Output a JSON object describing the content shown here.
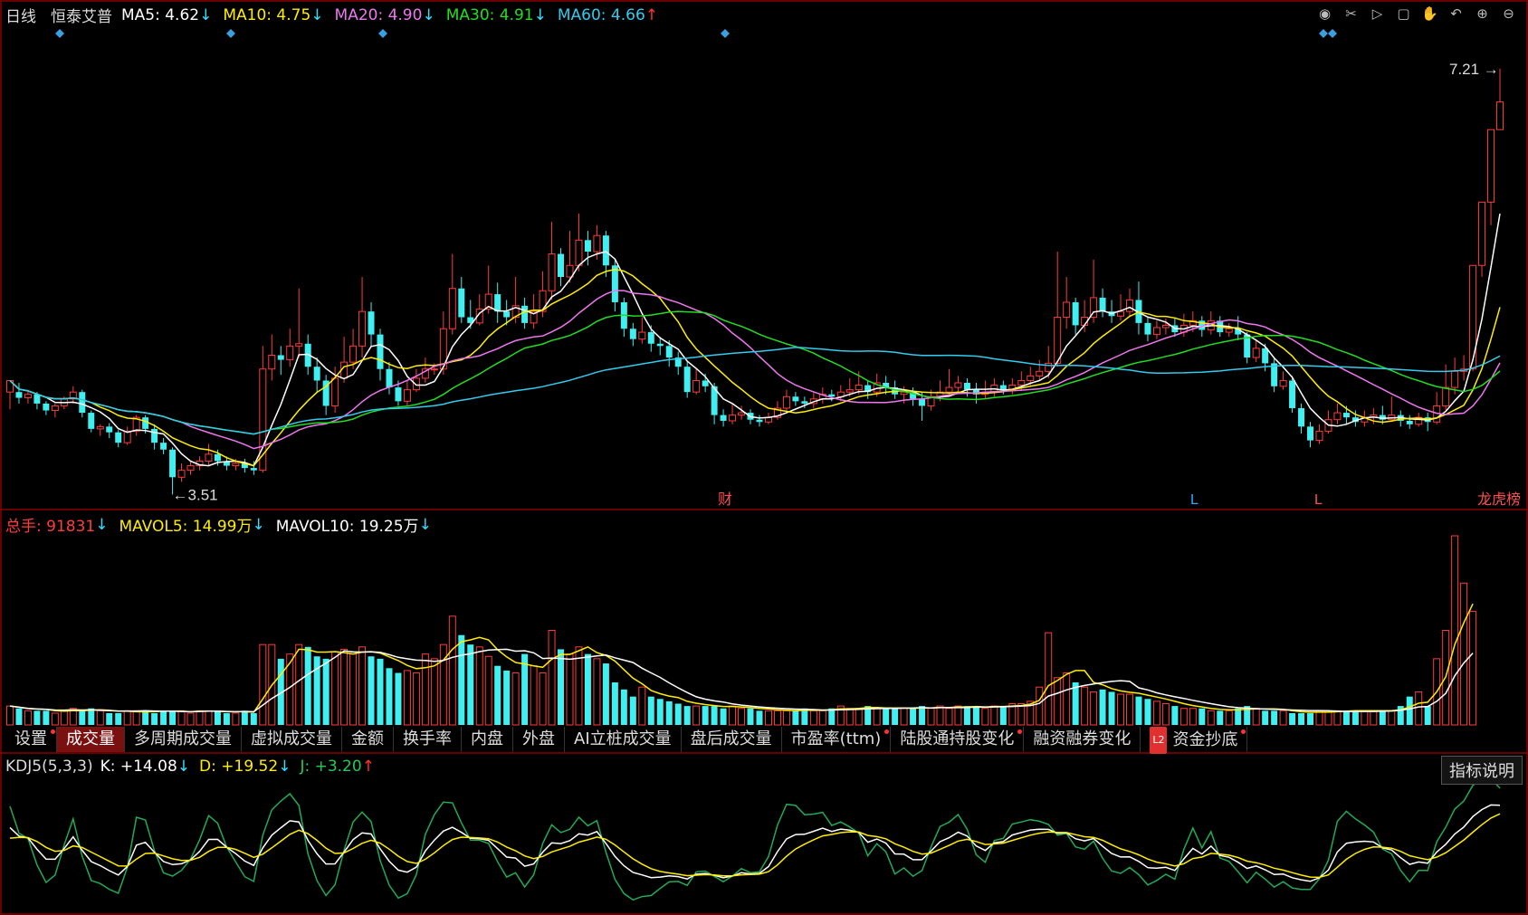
{
  "header": {
    "period": "日线",
    "stock_name": "恒泰艾普",
    "ma": [
      {
        "label": "MA5: 4.62",
        "arrow": "↓",
        "color": "#ffffff",
        "arrow_color": "#30e0ff"
      },
      {
        "label": "MA10: 4.75",
        "arrow": "↓",
        "color": "#ffee00",
        "arrow_color": "#30e0ff"
      },
      {
        "label": "MA20: 4.90",
        "arrow": "↓",
        "color": "#ee77ee",
        "arrow_color": "#30e0ff"
      },
      {
        "label": "MA30: 4.91",
        "arrow": "↓",
        "color": "#22dd22",
        "arrow_color": "#30e0ff"
      },
      {
        "label": "MA60: 4.66",
        "arrow": "↑",
        "color": "#33ccee",
        "arrow_color": "#ff3333"
      }
    ]
  },
  "price_annotations": {
    "high_label": "7.21",
    "low_label": "3.51"
  },
  "event_markers": [
    "财",
    "L",
    "L",
    "龙虎榜"
  ],
  "volume_header": {
    "total": "总手: 91831",
    "total_arrow": "↓",
    "mavol5": "MAVOL5: 14.99万",
    "mavol5_arrow": "↓",
    "mavol10": "MAVOL10: 19.25万",
    "mavol10_arrow": "↓"
  },
  "tabs": [
    {
      "label": "设置",
      "active": false,
      "dot": true
    },
    {
      "label": "成交量",
      "active": true,
      "dot": false
    },
    {
      "label": "多周期成交量",
      "active": false,
      "dot": false
    },
    {
      "label": "虚拟成交量",
      "active": false,
      "dot": false
    },
    {
      "label": "金额",
      "active": false,
      "dot": false
    },
    {
      "label": "换手率",
      "active": false,
      "dot": false
    },
    {
      "label": "内盘",
      "active": false,
      "dot": false
    },
    {
      "label": "外盘",
      "active": false,
      "dot": false
    },
    {
      "label": "AI立桩成交量",
      "active": false,
      "dot": false
    },
    {
      "label": "盘后成交量",
      "active": false,
      "dot": false
    },
    {
      "label": "市盈率(ttm)",
      "active": false,
      "dot": true
    },
    {
      "label": "陆股通持股变化",
      "active": false,
      "dot": true
    },
    {
      "label": "融资融券变化",
      "active": false,
      "dot": false
    },
    {
      "label": "资金抄底",
      "active": false,
      "dot": true,
      "badge": "L2"
    }
  ],
  "kdj_header": {
    "name": "KDJ5(5,3,3)",
    "k": "K: +14.08",
    "k_arrow": "↓",
    "d": "D: +19.52",
    "d_arrow": "↓",
    "j": "J: +3.20",
    "j_arrow": "↑"
  },
  "explain_button": "指标说明",
  "toolbar_icons": [
    "eye-icon",
    "scissors-icon",
    "play-icon",
    "lock-icon",
    "hand-icon",
    "undo-icon",
    "zoom-in-icon",
    "zoom-out-icon"
  ],
  "colors": {
    "up": "#ff3b3b",
    "down": "#40f0f0",
    "frame": "#8b0000"
  },
  "chart_data": {
    "type": "candlestick",
    "y_range_price": [
      3.45,
      7.35
    ],
    "ohlc": [
      [
        4.4,
        4.5,
        4.5,
        4.25
      ],
      [
        4.4,
        4.35,
        4.48,
        4.3
      ],
      [
        4.35,
        4.38,
        4.42,
        4.3
      ],
      [
        4.38,
        4.3,
        4.4,
        4.25
      ],
      [
        4.3,
        4.24,
        4.32,
        4.2
      ],
      [
        4.24,
        4.28,
        4.3,
        4.18
      ],
      [
        4.28,
        4.34,
        4.36,
        4.25
      ],
      [
        4.34,
        4.4,
        4.45,
        4.3
      ],
      [
        4.4,
        4.22,
        4.42,
        4.18
      ],
      [
        4.22,
        4.08,
        4.24,
        4.05
      ],
      [
        4.08,
        4.1,
        4.12,
        4.02
      ],
      [
        4.1,
        4.05,
        4.13,
        4.0
      ],
      [
        4.05,
        3.96,
        4.07,
        3.92
      ],
      [
        3.96,
        4.06,
        4.1,
        3.94
      ],
      [
        4.06,
        4.18,
        4.2,
        4.02
      ],
      [
        4.18,
        4.08,
        4.2,
        4.04
      ],
      [
        4.08,
        3.96,
        4.12,
        3.9
      ],
      [
        3.96,
        3.9,
        4.0,
        3.86
      ],
      [
        3.9,
        3.66,
        3.92,
        3.51
      ],
      [
        3.66,
        3.72,
        3.78,
        3.62
      ],
      [
        3.72,
        3.76,
        3.8,
        3.68
      ],
      [
        3.76,
        3.8,
        3.84,
        3.72
      ],
      [
        3.8,
        3.86,
        3.95,
        3.76
      ],
      [
        3.86,
        3.8,
        3.9,
        3.76
      ],
      [
        3.8,
        3.76,
        3.84,
        3.72
      ],
      [
        3.76,
        3.78,
        3.82,
        3.72
      ],
      [
        3.78,
        3.74,
        3.82,
        3.7
      ],
      [
        3.74,
        3.72,
        3.8,
        3.68
      ],
      [
        3.72,
        4.6,
        4.8,
        3.7
      ],
      [
        4.6,
        4.72,
        4.9,
        4.5
      ],
      [
        4.72,
        4.68,
        4.8,
        4.55
      ],
      [
        4.68,
        4.8,
        4.95,
        4.62
      ],
      [
        4.8,
        4.82,
        5.3,
        4.7
      ],
      [
        4.82,
        4.62,
        4.9,
        4.55
      ],
      [
        4.62,
        4.5,
        4.7,
        4.4
      ],
      [
        4.5,
        4.28,
        4.55,
        4.2
      ],
      [
        4.28,
        4.52,
        4.62,
        4.22
      ],
      [
        4.52,
        4.66,
        4.88,
        4.48
      ],
      [
        4.66,
        4.8,
        4.95,
        4.6
      ],
      [
        4.8,
        5.1,
        5.4,
        4.7
      ],
      [
        5.1,
        4.9,
        5.18,
        4.8
      ],
      [
        4.9,
        4.6,
        4.95,
        4.5
      ],
      [
        4.6,
        4.44,
        4.66,
        4.38
      ],
      [
        4.44,
        4.32,
        4.5,
        4.28
      ],
      [
        4.32,
        4.42,
        4.5,
        4.28
      ],
      [
        4.42,
        4.52,
        4.6,
        4.4
      ],
      [
        4.52,
        4.6,
        4.7,
        4.48
      ],
      [
        4.6,
        4.6,
        4.65,
        4.55
      ],
      [
        4.6,
        4.95,
        5.1,
        4.55
      ],
      [
        4.95,
        5.3,
        5.6,
        4.9
      ],
      [
        5.3,
        5.05,
        5.4,
        5.0
      ],
      [
        5.05,
        5.0,
        5.2,
        4.95
      ],
      [
        5.0,
        5.12,
        5.25,
        4.98
      ],
      [
        5.12,
        5.25,
        5.5,
        5.08
      ],
      [
        5.25,
        5.1,
        5.35,
        5.0
      ],
      [
        5.1,
        5.05,
        5.2,
        4.98
      ],
      [
        5.05,
        5.15,
        5.4,
        5.0
      ],
      [
        5.15,
        5.0,
        5.22,
        4.95
      ],
      [
        5.0,
        5.1,
        5.25,
        4.95
      ],
      [
        5.1,
        5.28,
        5.45,
        5.05
      ],
      [
        5.28,
        5.6,
        5.88,
        5.2
      ],
      [
        5.6,
        5.4,
        5.65,
        5.32
      ],
      [
        5.4,
        5.5,
        5.8,
        5.35
      ],
      [
        5.5,
        5.72,
        5.95,
        5.45
      ],
      [
        5.72,
        5.62,
        5.8,
        5.5
      ],
      [
        5.62,
        5.76,
        5.85,
        5.55
      ],
      [
        5.76,
        5.5,
        5.8,
        5.4
      ],
      [
        5.5,
        5.18,
        5.55,
        5.1
      ],
      [
        5.18,
        4.95,
        5.22,
        4.88
      ],
      [
        4.95,
        4.86,
        5.0,
        4.8
      ],
      [
        4.86,
        4.92,
        5.05,
        4.82
      ],
      [
        4.92,
        4.82,
        4.98,
        4.75
      ],
      [
        4.82,
        4.8,
        4.88,
        4.72
      ],
      [
        4.8,
        4.7,
        4.85,
        4.62
      ],
      [
        4.7,
        4.62,
        4.75,
        4.55
      ],
      [
        4.62,
        4.4,
        4.66,
        4.35
      ],
      [
        4.4,
        4.5,
        4.6,
        4.38
      ],
      [
        4.5,
        4.45,
        4.56,
        4.4
      ],
      [
        4.45,
        4.2,
        4.48,
        4.12
      ],
      [
        4.2,
        4.15,
        4.25,
        4.1
      ],
      [
        4.15,
        4.2,
        4.3,
        4.12
      ],
      [
        4.2,
        4.22,
        4.28,
        4.16
      ],
      [
        4.22,
        4.16,
        4.25,
        4.12
      ],
      [
        4.16,
        4.14,
        4.2,
        4.1
      ],
      [
        4.14,
        4.18,
        4.22,
        4.12
      ],
      [
        4.18,
        4.26,
        4.32,
        4.16
      ],
      [
        4.26,
        4.36,
        4.42,
        4.22
      ],
      [
        4.36,
        4.32,
        4.4,
        4.28
      ],
      [
        4.32,
        4.3,
        4.36,
        4.26
      ],
      [
        4.3,
        4.34,
        4.4,
        4.26
      ],
      [
        4.34,
        4.38,
        4.44,
        4.3
      ],
      [
        4.38,
        4.36,
        4.42,
        4.32
      ],
      [
        4.36,
        4.4,
        4.46,
        4.32
      ],
      [
        4.4,
        4.42,
        4.52,
        4.36
      ],
      [
        4.42,
        4.46,
        4.58,
        4.38
      ],
      [
        4.46,
        4.4,
        4.5,
        4.34
      ],
      [
        4.4,
        4.48,
        4.56,
        4.36
      ],
      [
        4.48,
        4.44,
        4.54,
        4.38
      ],
      [
        4.44,
        4.38,
        4.5,
        4.34
      ],
      [
        4.38,
        4.4,
        4.45,
        4.3
      ],
      [
        4.4,
        4.34,
        4.44,
        4.28
      ],
      [
        4.34,
        4.28,
        4.4,
        4.15
      ],
      [
        4.28,
        4.36,
        4.42,
        4.24
      ],
      [
        4.36,
        4.4,
        4.5,
        4.32
      ],
      [
        4.4,
        4.44,
        4.6,
        4.36
      ],
      [
        4.44,
        4.48,
        4.54,
        4.4
      ],
      [
        4.48,
        4.42,
        4.52,
        4.36
      ],
      [
        4.42,
        4.38,
        4.48,
        4.3
      ],
      [
        4.38,
        4.4,
        4.5,
        4.34
      ],
      [
        4.4,
        4.46,
        4.52,
        4.36
      ],
      [
        4.46,
        4.42,
        4.5,
        4.38
      ],
      [
        4.42,
        4.46,
        4.52,
        4.38
      ],
      [
        4.46,
        4.5,
        4.58,
        4.42
      ],
      [
        4.5,
        4.54,
        4.62,
        4.46
      ],
      [
        4.54,
        4.58,
        4.68,
        4.5
      ],
      [
        4.58,
        4.65,
        4.8,
        4.52
      ],
      [
        4.65,
        5.05,
        5.62,
        4.62
      ],
      [
        5.05,
        5.18,
        5.4,
        4.95
      ],
      [
        5.18,
        4.98,
        5.22,
        4.9
      ],
      [
        4.98,
        5.05,
        5.2,
        4.92
      ],
      [
        5.05,
        5.22,
        5.55,
        5.0
      ],
      [
        5.22,
        5.1,
        5.3,
        5.05
      ],
      [
        5.1,
        5.06,
        5.2,
        5.0
      ],
      [
        5.06,
        5.1,
        5.25,
        5.02
      ],
      [
        5.1,
        5.2,
        5.3,
        5.05
      ],
      [
        5.2,
        5.0,
        5.36,
        4.9
      ],
      [
        5.0,
        4.9,
        5.05,
        4.84
      ],
      [
        4.9,
        4.96,
        5.02,
        4.86
      ],
      [
        4.96,
        4.98,
        5.04,
        4.9
      ],
      [
        4.98,
        4.92,
        5.05,
        4.88
      ],
      [
        4.92,
        4.98,
        5.08,
        4.88
      ],
      [
        4.98,
        5.02,
        5.1,
        4.92
      ],
      [
        5.02,
        4.94,
        5.06,
        4.88
      ],
      [
        4.94,
        5.02,
        5.1,
        4.9
      ],
      [
        5.02,
        4.92,
        5.06,
        4.88
      ],
      [
        4.92,
        4.95,
        5.0,
        4.88
      ],
      [
        4.95,
        4.9,
        5.06,
        4.85
      ],
      [
        4.9,
        4.7,
        4.92,
        4.65
      ],
      [
        4.7,
        4.78,
        4.85,
        4.66
      ],
      [
        4.78,
        4.65,
        4.82,
        4.58
      ],
      [
        4.65,
        4.45,
        4.7,
        4.4
      ],
      [
        4.45,
        4.5,
        4.58,
        4.42
      ],
      [
        4.5,
        4.26,
        4.54,
        4.22
      ],
      [
        4.26,
        4.1,
        4.3,
        4.04
      ],
      [
        4.1,
        3.98,
        4.14,
        3.92
      ],
      [
        3.98,
        4.06,
        4.12,
        3.95
      ],
      [
        4.06,
        4.16,
        4.24,
        4.04
      ],
      [
        4.16,
        4.22,
        4.3,
        4.12
      ],
      [
        4.22,
        4.18,
        4.28,
        4.12
      ],
      [
        4.18,
        4.14,
        4.24,
        4.1
      ],
      [
        4.14,
        4.18,
        4.24,
        4.1
      ],
      [
        4.18,
        4.2,
        4.26,
        4.12
      ],
      [
        4.2,
        4.16,
        4.28,
        4.12
      ],
      [
        4.16,
        4.2,
        4.36,
        4.14
      ],
      [
        4.2,
        4.15,
        4.24,
        4.1
      ],
      [
        4.15,
        4.12,
        4.2,
        4.08
      ],
      [
        4.12,
        4.18,
        4.22,
        4.1
      ],
      [
        4.18,
        4.14,
        4.22,
        4.06
      ],
      [
        4.14,
        4.28,
        4.4,
        4.12
      ],
      [
        4.28,
        4.44,
        4.64,
        4.24
      ],
      [
        4.44,
        4.58,
        4.7,
        4.38
      ],
      [
        4.58,
        4.6,
        4.72,
        4.5
      ],
      [
        4.6,
        5.5,
        5.5,
        4.58
      ],
      [
        5.5,
        6.05,
        6.05,
        5.4
      ],
      [
        6.05,
        6.68,
        6.68,
        5.85
      ],
      [
        6.68,
        6.92,
        7.21,
        6.85
      ]
    ],
    "volume": [
      8,
      7,
      6,
      6,
      6,
      5,
      6,
      7,
      6,
      7,
      6,
      5,
      5,
      6,
      6,
      6,
      5,
      6,
      6,
      6,
      5,
      6,
      6,
      6,
      5,
      5,
      6,
      5,
      34,
      34,
      28,
      30,
      34,
      33,
      29,
      28,
      31,
      32,
      30,
      33,
      29,
      28,
      24,
      22,
      23,
      22,
      30,
      28,
      34,
      46,
      38,
      34,
      33,
      29,
      25,
      23,
      22,
      30,
      25,
      22,
      40,
      32,
      30,
      33,
      30,
      28,
      26,
      18,
      15,
      12,
      16,
      12,
      11,
      10,
      9,
      8,
      8,
      8,
      8,
      7,
      8,
      7,
      7,
      6,
      6,
      6,
      6,
      6,
      7,
      6,
      6,
      7,
      8,
      7,
      7,
      8,
      7,
      7,
      7,
      7,
      7,
      8,
      7,
      8,
      7,
      8,
      8,
      8,
      7,
      8,
      8,
      9,
      9,
      10,
      16,
      39,
      20,
      22,
      18,
      16,
      14,
      15,
      14,
      13,
      13,
      12,
      11,
      10,
      9,
      8,
      7,
      7,
      7,
      6,
      6,
      6,
      7,
      8,
      7,
      6,
      6,
      6,
      5,
      5,
      5,
      6,
      6,
      6,
      6,
      6,
      6,
      6,
      6,
      6,
      8,
      12,
      14,
      8,
      28,
      40,
      80,
      60,
      48
    ],
    "series": [
      {
        "name": "MA5",
        "color": "#ffffff"
      },
      {
        "name": "MA10",
        "color": "#ffee00"
      },
      {
        "name": "MA20",
        "color": "#ee77ee"
      },
      {
        "name": "MA30",
        "color": "#22dd22"
      },
      {
        "name": "MA60",
        "color": "#33ccee"
      },
      {
        "name": "MAVOL5",
        "color": "#ffee00"
      },
      {
        "name": "MAVOL10",
        "color": "#ffffff"
      },
      {
        "name": "K",
        "color": "#ffffff"
      },
      {
        "name": "D",
        "color": "#ffee00"
      },
      {
        "name": "J",
        "color": "#22aa55"
      }
    ]
  }
}
